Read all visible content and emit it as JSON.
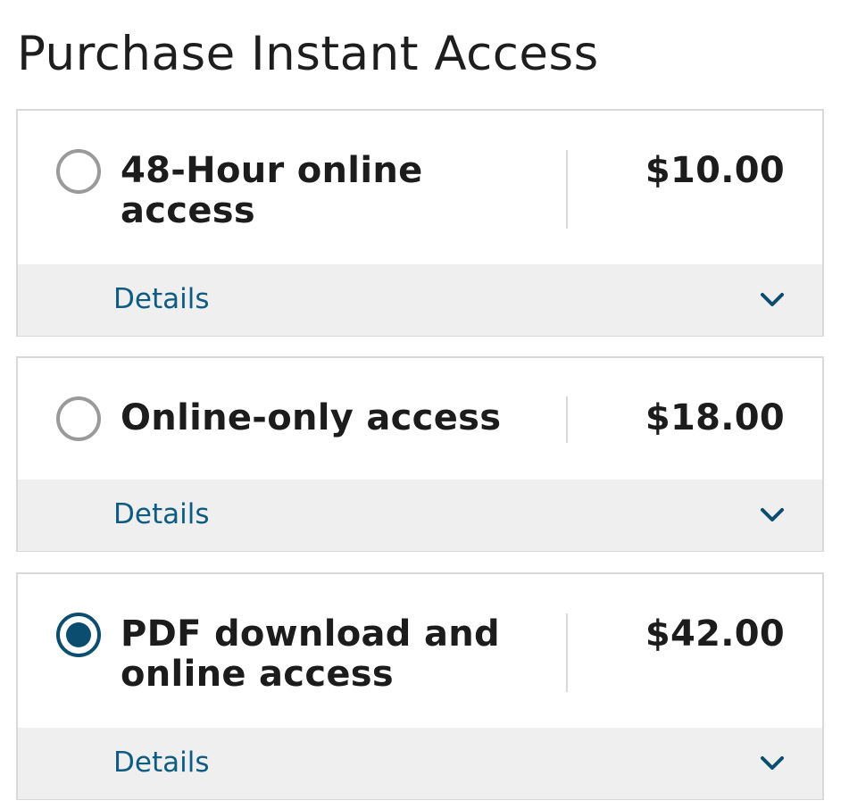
{
  "title": "Purchase Instant Access",
  "options": [
    {
      "label": "48-Hour online access",
      "price": "$10.00",
      "details_label": "Details",
      "selected": false
    },
    {
      "label": "Online-only access",
      "price": "$18.00",
      "details_label": "Details",
      "selected": false
    },
    {
      "label": "PDF download and online access",
      "price": "$42.00",
      "details_label": "Details",
      "selected": true
    }
  ],
  "colors": {
    "accent": "#0a4d6e",
    "link": "#0f5c82",
    "radio_unselected": "#9a9a9a",
    "details_background": "#efefef",
    "border": "#d9d9d9"
  },
  "icons": {
    "expand": "chevron-down-icon"
  }
}
